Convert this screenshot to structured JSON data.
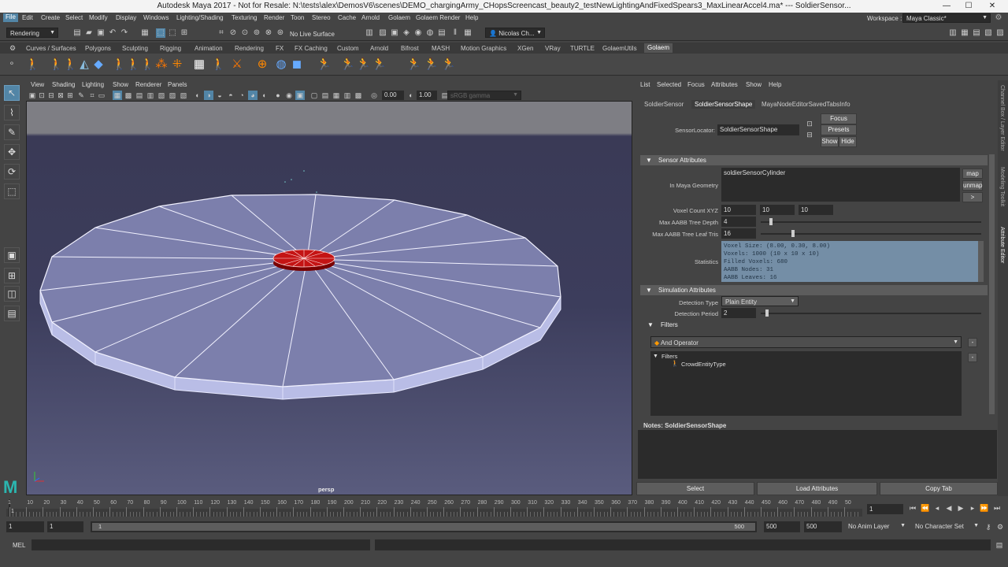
{
  "title_bar": {
    "title": "Autodesk Maya 2017 - Not for Resale: N:\\tests\\alex\\DemosV6\\scenes\\DEMO_chargingArmy_CHopsScreencast_beauty2_testNewLightingAndFixedSpears3_MaxLinearAccel4.ma*   ---   SoldierSensor...",
    "minimize": "—",
    "maximize": "☐",
    "close": "✕"
  },
  "menu": [
    "File",
    "Edit",
    "Create",
    "Select",
    "Modify",
    "Display",
    "Windows",
    "Lighting/Shading",
    "Texturing",
    "Render",
    "Toon",
    "Stereo",
    "Cache",
    "Arnold",
    "Golaem",
    "Golaem Render",
    "Help"
  ],
  "workspace": {
    "label": "Workspace :",
    "value": "Maya Classic*"
  },
  "status_line": {
    "menuset": "Rendering",
    "live_surface": "No Live Surface",
    "user": "Nicolas Ch..."
  },
  "shelf_tabs": [
    "Curves / Surfaces",
    "Polygons",
    "Sculpting",
    "Rigging",
    "Animation",
    "Rendering",
    "FX",
    "FX Caching",
    "Custom",
    "Arnold",
    "Bifrost",
    "MASH",
    "Motion Graphics",
    "XGen",
    "VRay",
    "TURTLE",
    "GolaemUtils",
    "Golaem"
  ],
  "shelf_active": "Golaem",
  "viewport": {
    "menu": [
      "View",
      "Shading",
      "Lighting",
      "Show",
      "Renderer",
      "Panels"
    ],
    "exposure": "0.00",
    "gamma": "1.00",
    "color_space": "sRGB gamma",
    "camera_label": "persp"
  },
  "attribute_editor": {
    "menu": [
      "List",
      "Selected",
      "Focus",
      "Attributes",
      "Show",
      "Help"
    ],
    "tabs": [
      "SoldierSensor",
      "SoldierSensorShape",
      "MayaNodeEditorSavedTabsInfo"
    ],
    "active_tab": "SoldierSensorShape",
    "node_label": "SensorLocator:",
    "node_value": "SoldierSensorShape",
    "focus_btn": "Focus",
    "presets_btn": "Presets",
    "show_btn": "Show",
    "hide_btn": "Hide",
    "sections": {
      "sensor": "Sensor Attributes",
      "simulation": "Simulation Attributes",
      "filters": "Filters"
    },
    "in_maya_geometry": {
      "label": "In Maya Geometry",
      "value": "soldierSensorCylinder",
      "map_btn": "map",
      "unmap_btn": "unmap",
      "more_btn": ">"
    },
    "voxel_count": {
      "label": "Voxel Count XYZ",
      "x": "10",
      "y": "10",
      "z": "10"
    },
    "max_depth": {
      "label": "Max AABB Tree Depth",
      "value": "4",
      "slider": 0.04
    },
    "max_leaf": {
      "label": "Max AABB Tree Leaf Tris",
      "value": "16",
      "slider": 0.14
    },
    "statistics": {
      "label": "Statistics",
      "text": "Voxel Size: (8.00, 0.30, 8.00)\nVoxels: 1000 (10 x 10 x 10)\nFilled Voxels: 680\nAABB Nodes: 31\nAABB Leaves: 16"
    },
    "detection_type": {
      "label": "Detection Type",
      "value": "Plain Entity"
    },
    "detection_period": {
      "label": "Detection Period",
      "value": "2",
      "slider": 0.02
    },
    "operator": "And Operator",
    "filters_tree": {
      "root": "Filters",
      "child": "CrowdEntityType"
    },
    "notes": "Notes:  SoldierSensorShape",
    "bottom_buttons": [
      "Select",
      "Load Attributes",
      "Copy Tab"
    ]
  },
  "side_tabs": [
    "Channel Box / Layer Editor",
    "Modeling Toolkit",
    "Attribute Editor"
  ],
  "timeline": {
    "ticks": [
      "1",
      "10",
      "20",
      "30",
      "40",
      "50",
      "60",
      "70",
      "80",
      "90",
      "100",
      "110",
      "120",
      "130",
      "140",
      "150",
      "160",
      "170",
      "180",
      "190",
      "200",
      "210",
      "220",
      "230",
      "240",
      "250",
      "260",
      "270",
      "280",
      "290",
      "300",
      "310",
      "320",
      "330",
      "340",
      "350",
      "360",
      "370",
      "380",
      "390",
      "400",
      "410",
      "420",
      "430",
      "440",
      "450",
      "460",
      "470",
      "480",
      "490",
      "50"
    ],
    "current": "1",
    "first_tick": "1"
  },
  "range": {
    "start": "1",
    "playback_start": "1",
    "slider_start": "1",
    "slider_end": "500",
    "playback_end": "500",
    "end": "500",
    "anim_layer": "No Anim Layer",
    "character_set": "No Character Set"
  },
  "command_line": {
    "label": "MEL"
  }
}
